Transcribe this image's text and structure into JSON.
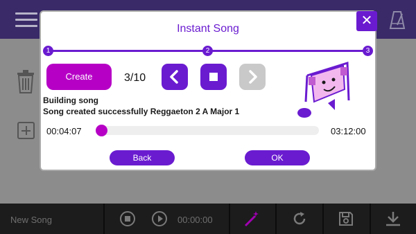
{
  "background": {
    "bottom_bar": {
      "song_name": "New Song",
      "time": "00:00:00"
    }
  },
  "dialog": {
    "title": "Instant Song",
    "close_symbol": "✕",
    "steps": [
      "1",
      "2",
      "3"
    ],
    "create_label": "Create",
    "counter": "3/10",
    "log": [
      "Building song",
      "Song created successfully Reggaeton 2 A Major 1"
    ],
    "time_elapsed": "00:04:07",
    "time_total": "03:12:00",
    "progress": 0.021,
    "back_label": "Back",
    "ok_label": "OK"
  },
  "colors": {
    "accent_purple": "#6a1bd0",
    "accent_magenta": "#b600c6",
    "disabled_grey": "#c9c9c9",
    "topbar": "#3a2a68",
    "bottombar": "#1c1c1c"
  },
  "icons": [
    "menu-icon",
    "metronome-icon",
    "trash-icon",
    "add-box-icon",
    "close-icon",
    "previous-icon",
    "stop-icon",
    "next-icon",
    "music-note-character-icon",
    "stop-circle-icon",
    "play-circle-icon",
    "magic-wand-icon",
    "refresh-icon",
    "save-icon",
    "download-icon"
  ]
}
